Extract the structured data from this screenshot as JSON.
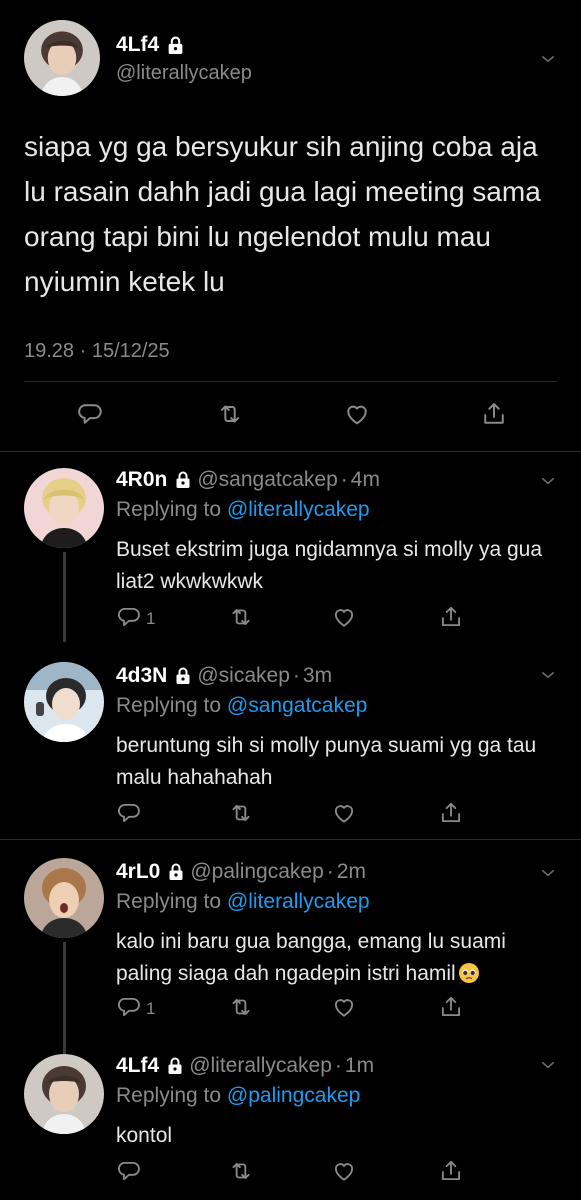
{
  "main_tweet": {
    "name": "4Lf4",
    "handle": "@literallycakep",
    "text": "siapa yg ga bersyukur sih anjing coba aja lu rasain dahh jadi gua lagi meeting sama orang tapi bini lu ngelendot mulu mau nyiumin ketek lu",
    "timestamp": "19.28 · 15/12/25"
  },
  "replies": [
    {
      "name": "4R0n",
      "handle": "@sangatcakep",
      "dot": "·",
      "time": "4m",
      "replying_prefix": "Replying to",
      "replying_to": "@literallycakep",
      "text": "Buset ekstrim juga ngidamnya si molly ya gua liat2 wkwkwkwk",
      "reply_count": "1"
    },
    {
      "name": "4d3N",
      "handle": "@sicakep",
      "dot": "·",
      "time": "3m",
      "replying_prefix": "Replying to",
      "replying_to": "@sangatcakep",
      "text": "beruntung sih si molly punya suami yg ga tau malu hahahahah",
      "reply_count": ""
    },
    {
      "name": "4rL0",
      "handle": "@palingcakep",
      "dot": "·",
      "time": "2m",
      "replying_prefix": "Replying to",
      "replying_to": "@literallycakep",
      "text": "kalo ini baru gua bangga, emang lu suami paling siaga dah ngadepin istri hamil",
      "reply_count": "1"
    },
    {
      "name": "4Lf4",
      "handle": "@literallycakep",
      "dot": "·",
      "time": "1m",
      "replying_prefix": "Replying to",
      "replying_to": "@palingcakep",
      "text": "kontol",
      "reply_count": ""
    }
  ],
  "colors": {
    "background": "#000000",
    "text": "#e7e7e7",
    "muted": "#8a8a8a",
    "mention": "#1d9bf0",
    "divider": "#2b2b2b"
  },
  "icons": [
    "lock-icon",
    "chevron-down-icon",
    "reply-icon",
    "retweet-icon",
    "like-icon",
    "share-icon",
    "pleading-face-emoji"
  ]
}
